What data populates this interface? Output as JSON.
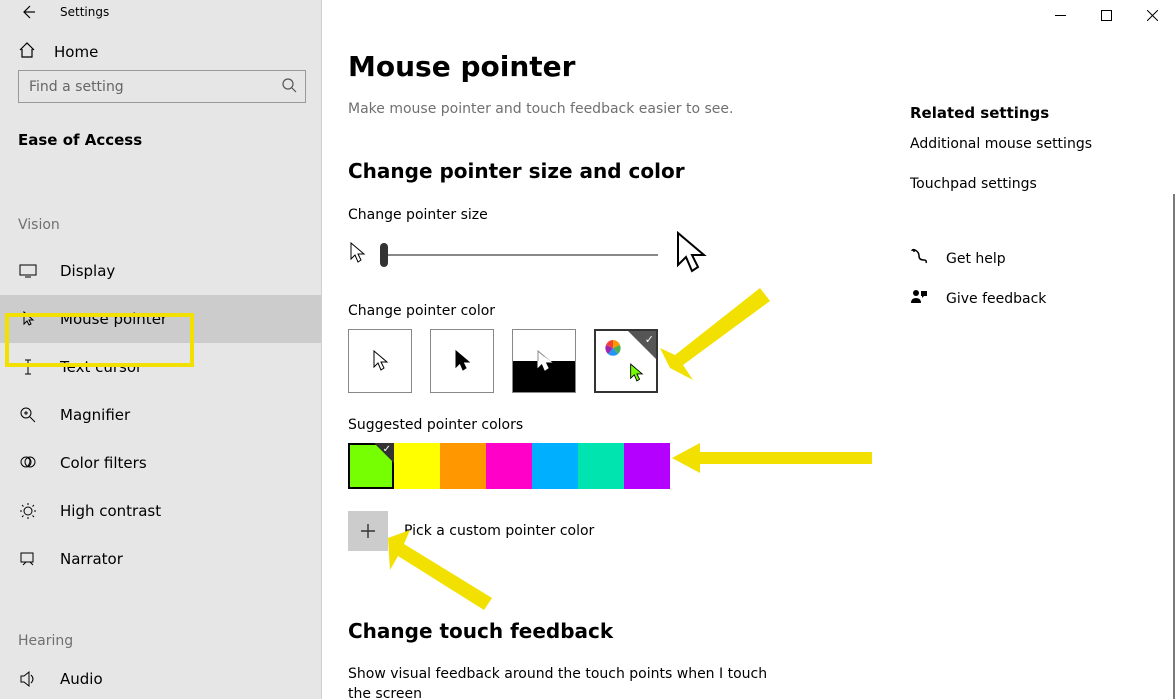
{
  "app_title": "Settings",
  "home_label": "Home",
  "search_placeholder": "Find a setting",
  "section_title": "Ease of Access",
  "group_vision": "Vision",
  "group_hearing": "Hearing",
  "nav": {
    "display": "Display",
    "mouse_pointer": "Mouse pointer",
    "text_cursor": "Text cursor",
    "magnifier": "Magnifier",
    "color_filters": "Color filters",
    "high_contrast": "High contrast",
    "narrator": "Narrator",
    "audio": "Audio"
  },
  "page": {
    "title": "Mouse pointer",
    "subtitle": "Make mouse pointer and touch feedback easier to see.",
    "section_size_color": "Change pointer size and color",
    "label_size": "Change pointer size",
    "label_color": "Change pointer color",
    "label_suggested": "Suggested pointer colors",
    "custom_label": "Pick a custom pointer color",
    "section_touch": "Change touch feedback",
    "touch_desc": "Show visual feedback around the touch points when I touch the screen"
  },
  "suggested_colors": [
    "#76ff03",
    "#ffff00",
    "#ff9800",
    "#ff00c8",
    "#00b0ff",
    "#00e5b0",
    "#b400ff"
  ],
  "selected_color_index": 0,
  "right": {
    "related_title": "Related settings",
    "link_mouse": "Additional mouse settings",
    "link_touchpad": "Touchpad settings",
    "help": "Get help",
    "feedback": "Give feedback"
  }
}
